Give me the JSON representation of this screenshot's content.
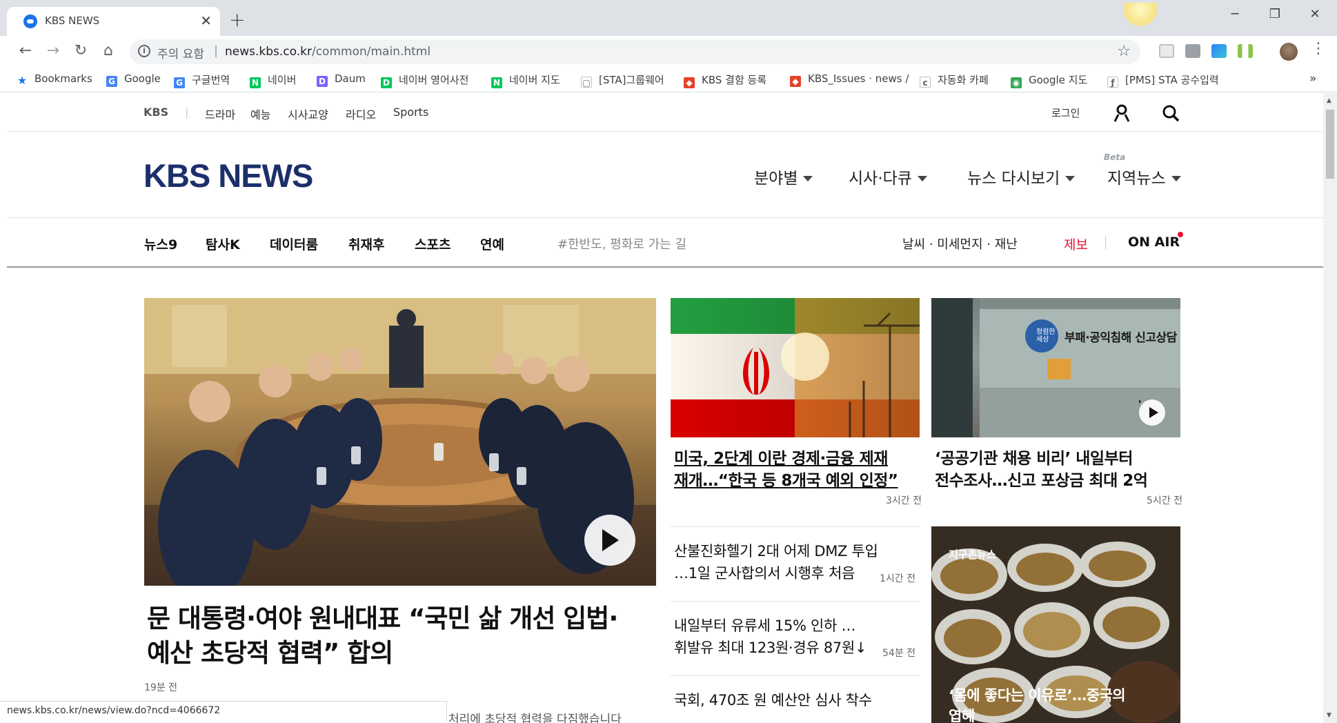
{
  "browser": {
    "tab_title": "KBS NEWS",
    "tab_close": "✕",
    "new_tab": "+",
    "window_controls": {
      "minimize": "─",
      "maximize": "❐",
      "close": "✕"
    },
    "nav": {
      "back": "←",
      "forward": "→",
      "reload": "↻",
      "home": "⌂"
    },
    "security_icon": "i",
    "security_label": "주의 요함",
    "separator": "|",
    "url_host": "news.kbs.co.kr",
    "url_path": "/common/main.html",
    "bookmark_star": "☆",
    "menu": "⋮",
    "bookmarks_overflow": "»",
    "bookmarks": [
      {
        "label": "Bookmarks",
        "icon": "★",
        "color": "#1a73e8"
      },
      {
        "label": "Google",
        "icon": "G",
        "color": "#4285f4"
      },
      {
        "label": "구글번역",
        "icon": "G",
        "color": "#4285f4"
      },
      {
        "label": "네이버",
        "icon": "N",
        "color": "#03c75a"
      },
      {
        "label": "Daum",
        "icon": "D",
        "color": "#7b61ff"
      },
      {
        "label": "네이버 영어사전",
        "icon": "D",
        "color": "#03c75a"
      },
      {
        "label": "네이버 지도",
        "icon": "N",
        "color": "#03c75a"
      },
      {
        "label": "[STA]그룹웨어",
        "icon": "▢",
        "color": "#ffffff"
      },
      {
        "label": "KBS 결함 등록",
        "icon": "◆",
        "color": "#e24329"
      },
      {
        "label": "KBS_Issues · news / ",
        "icon": "◆",
        "color": "#e24329"
      },
      {
        "label": "자동화 카페",
        "icon": "c",
        "color": "#ffffff"
      },
      {
        "label": "Google 지도",
        "icon": "◉",
        "color": "#34a853"
      },
      {
        "label": "[PMS] STA 공수입력",
        "icon": "ƒ",
        "color": "#ffffff"
      }
    ],
    "status_url": "news.kbs.co.kr/news/view.do?ncd=4066672"
  },
  "site": {
    "top_nav": [
      "KBS",
      "드라마",
      "예능",
      "시사교양",
      "라디오",
      "Sports"
    ],
    "top_nav_divider": "|",
    "login": "로그인",
    "logo": "KBS NEWS",
    "main_menu": [
      "분야별",
      "시사·다큐",
      "뉴스 다시보기",
      "지역뉴스"
    ],
    "beta_label": "Beta",
    "sub_nav": [
      "뉴스9",
      "탐사K",
      "데이터룸",
      "취재후",
      "스포츠",
      "연예"
    ],
    "campaign_tag": "#한반도, 평화로 가는 길",
    "weather": "날씨 · 미세먼지 · 재난",
    "report": "제보",
    "on_air": "ON AIR",
    "colors": {
      "logo": "#1d2f6b",
      "report": "#e8112d",
      "on_air_dot": "#e8112d"
    }
  },
  "articles": {
    "main": {
      "title_line1": "문 대통령·여야 원내대표 “국민 삶 개선 입법·",
      "title_line2": "예산 초당적 협력” 합의",
      "time": "19분 전",
      "cutoff_text": "처리에 초당적 협력을 다짐했습니다"
    },
    "iran": {
      "line1": "미국, 2단계 이란 경제·금융 제재",
      "line2": "재개…“한국 등 8개국 예외 인정”",
      "time": "3시간 전"
    },
    "public": {
      "line1": "‘공공기관 채용 비리’ 내일부터",
      "line2": "전수조사…신고 포상금 최대 2억",
      "time": "5시간 전",
      "sign_text": "부패·공익침해 신고상담",
      "sign_badge": "청렴한세상"
    },
    "list": [
      {
        "line1": "산불진화헬기 2대 어제 DMZ 투입",
        "line2": "…1일 군사합의서 시행후 처음",
        "time": "1시간 전"
      },
      {
        "line1": "내일부터 유류세 15% 인하 …",
        "line2": "휘발유 최대 123원·경유 87원↓",
        "time": "54분 전"
      },
      {
        "line1": "국회, 470조 원 예산안 심사 착수",
        "line2": "",
        "time": ""
      }
    ],
    "global": {
      "label": "지구촌뉴스",
      "title_line1": "‘몸에 좋다는 이유로’…중국의",
      "title_line2": "엽혜"
    }
  }
}
